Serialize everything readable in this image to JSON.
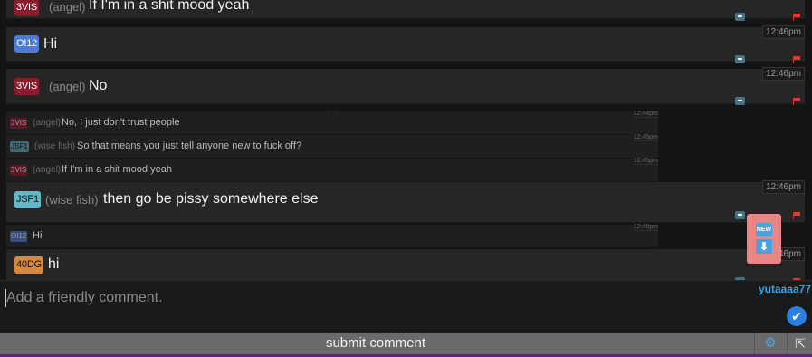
{
  "messages": [
    {
      "badge": "3VIS",
      "name": "(angel)",
      "text": "If I'm in a shit mood yeah",
      "time": ""
    },
    {
      "badge": "OI12",
      "name": "",
      "text": "Hi",
      "time": "12:46pm"
    },
    {
      "badge": "3VIS",
      "name": "(angel)",
      "text": "No",
      "time": "12:46pm"
    },
    {
      "badge": "JSF1",
      "name": "(wise fish)",
      "text": "then go be pissy somewhere else",
      "time": "12:46pm"
    },
    {
      "badge": "40DG",
      "name": "",
      "text": "hi",
      "time": "12:46pm"
    }
  ],
  "quoted": [
    {
      "badge": "3VIS",
      "name": "(angel)",
      "text": "No, I just don't trust people",
      "time": "12:44pm"
    },
    {
      "badge": "JSF1",
      "name": "(wise fish)",
      "text": "So that means you just tell anyone new to fuck off?",
      "time": "12:45pm"
    },
    {
      "badge": "3VIS",
      "name": "(angel)",
      "text": "If I'm in a shit mood yeah",
      "time": "12:45pm"
    },
    {
      "badge": "OI12",
      "name": "",
      "text": "Hi",
      "time": "12:46pm"
    }
  ],
  "expand_dots": "•••",
  "new_button": {
    "new_label": "NEW",
    "arrow": "⬇"
  },
  "composer": {
    "placeholder": "Add a friendly comment.",
    "value": "",
    "username": "yutaaaa77"
  },
  "submit": {
    "label": "submit comment",
    "settings_icon": "⚙",
    "popout_icon": "⇱",
    "check_icon": "✔"
  },
  "colors": {
    "badge_red": "#8a1c2c",
    "badge_blue": "#4b7bd6",
    "badge_teal": "#5fb9c8",
    "badge_orange": "#d8873f",
    "username": "#3aa2e6",
    "new_button": "#e88585"
  },
  "icons": [
    "reply-icon",
    "flag-icon",
    "gear-icon",
    "popout-icon",
    "check-icon"
  ]
}
